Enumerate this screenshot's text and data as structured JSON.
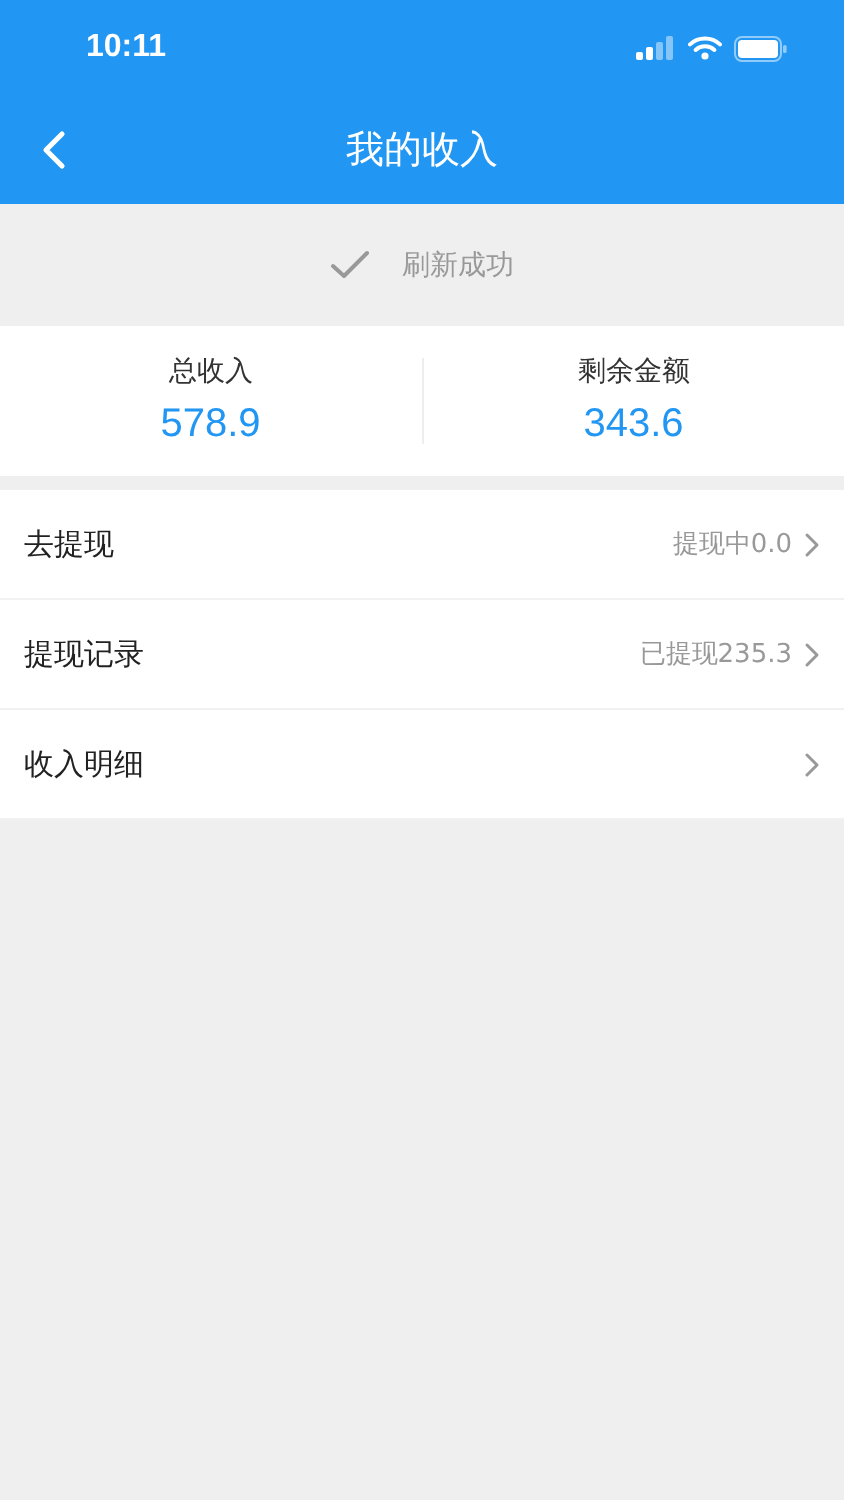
{
  "status_bar": {
    "time": "10:11"
  },
  "nav": {
    "title": "我的收入"
  },
  "refresh": {
    "message": "刷新成功"
  },
  "summary": [
    {
      "label": "总收入",
      "value": "578.9"
    },
    {
      "label": "剩余金额",
      "value": "343.6"
    }
  ],
  "menu": [
    {
      "label": "去提现",
      "detail": "提现中0.0"
    },
    {
      "label": "提现记录",
      "detail": "已提现235.3"
    },
    {
      "label": "收入明细"
    }
  ]
}
